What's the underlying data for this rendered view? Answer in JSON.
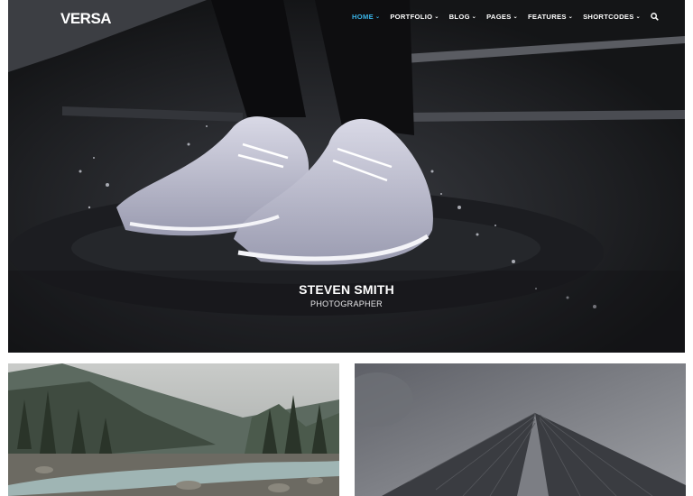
{
  "header": {
    "logo": "VERSA",
    "nav": [
      {
        "label": "HOME",
        "active": true
      },
      {
        "label": "PORTFOLIO",
        "active": false
      },
      {
        "label": "BLOG",
        "active": false
      },
      {
        "label": "PAGES",
        "active": false
      },
      {
        "label": "FEATURES",
        "active": false
      },
      {
        "label": "SHORTCODES",
        "active": false
      }
    ],
    "accent_color": "#3ab3e6"
  },
  "hero": {
    "name": "STEVEN SMITH",
    "role": "PHOTOGRAPHER"
  },
  "gallery": [
    {
      "subject": "misty forest river"
    },
    {
      "subject": "skyscraper from below"
    }
  ]
}
